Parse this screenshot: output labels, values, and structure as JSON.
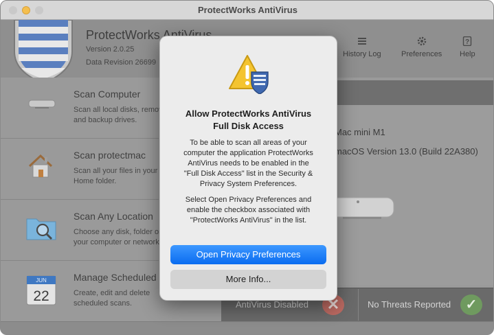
{
  "window": {
    "title": "ProtectWorks AntiVirus"
  },
  "header": {
    "app_name": "ProtectWorks AntiVirus",
    "version": "Version 2.0.25",
    "data_revision": "Data Revision 26699"
  },
  "toolbar": {
    "items": [
      {
        "label": "History Log",
        "icon": "list-icon"
      },
      {
        "label": "Preferences",
        "icon": "gear-icon"
      },
      {
        "label": "Help",
        "icon": "question-icon"
      }
    ]
  },
  "sidebar": {
    "items": [
      {
        "title": "Scan Computer",
        "desc_line1": "Scan all local disks, removable",
        "desc_line2": "and backup drives.",
        "icon": "mac-mini-icon"
      },
      {
        "title": "Scan protectmac",
        "desc_line1": "Scan all your files in your",
        "desc_line2": "Home folder.",
        "icon": "home-icon"
      },
      {
        "title": "Scan Any Location",
        "desc_line1": "Choose any disk, folder or file on",
        "desc_line2": "your computer or network.",
        "icon": "folder-search-icon"
      },
      {
        "title": "Manage Scheduled Scans",
        "desc_line1": "Create, edit and delete",
        "desc_line2": "scheduled scans.",
        "icon": "calendar-icon",
        "calendar_month": "JUN",
        "calendar_day": "22"
      }
    ]
  },
  "computer": {
    "model": "Mac mini M1",
    "os": "macOS Version 13.0 (Build 22A380)"
  },
  "status": {
    "antivirus": "AntiVirus Disabled",
    "threats": "No Threats Reported"
  },
  "dialog": {
    "title_line1": "Allow ProtectWorks AntiVirus",
    "title_line2": "Full Disk Access",
    "message1": [
      "To be able to scan all areas of your",
      "computer the application ProtectWorks",
      "AntiVirus needs to be enabled in the",
      "\"Full Disk Access\" list in the Security &",
      "Privacy System Preferences."
    ],
    "message2": [
      "Select Open Privacy Preferences and",
      "enable the checkbox associated with",
      "\"ProtectWorks AntiVirus\" in the list."
    ],
    "primary_button": "Open Privacy Preferences",
    "secondary_button": "More Info..."
  },
  "colors": {
    "accent": "#0a6cf0",
    "warning": "#f4c430",
    "shield_blue": "#3f68b0",
    "ok_green": "#6f9a5f",
    "error_red": "#bc6a62"
  }
}
